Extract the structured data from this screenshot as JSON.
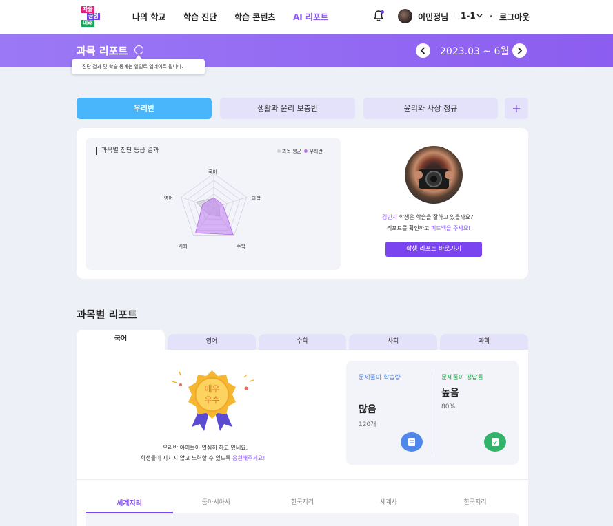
{
  "nav": {
    "logo_lines": [
      "자율",
      "균형",
      "미래"
    ],
    "items": [
      "나의 학교",
      "학습 진단",
      "학습 콘텐츠",
      "AI 리포트"
    ],
    "active_index": 3,
    "user_name": "이민정님",
    "class_select": "1-1",
    "logout": "로그아웃"
  },
  "banner": {
    "title": "과목 리포트",
    "info_icon": "i",
    "date_range": "2023.03 ~ 6월",
    "tooltip": "진단 결과 및 학습 통계는 일일로 업데이트 됩니다."
  },
  "class_tabs": [
    "우리반",
    "생활과 윤리 보충반",
    "윤리와 사상 정규"
  ],
  "class_tab_add": "+",
  "radar": {
    "title": "과목별 진단 등급 결과",
    "legend": [
      {
        "name": "과목 평균",
        "color": "#d0d0d8"
      },
      {
        "name": "우리반",
        "color": "#c07af0"
      }
    ]
  },
  "chart_data": {
    "type": "radar",
    "title": "과목별 진단 등급 결과",
    "categories": [
      "국어",
      "과학",
      "수학",
      "사회",
      "영어"
    ],
    "max": 5,
    "series": [
      {
        "name": "과목 평균",
        "values": [
          1.4,
          0.8,
          1.5,
          1.2,
          2.7
        ]
      },
      {
        "name": "우리반",
        "values": [
          1.5,
          1.4,
          4.8,
          4.5,
          1.7
        ]
      }
    ]
  },
  "student": {
    "name": "김민지",
    "msg1_rest": " 학생은 학습을 잘하고 있을까요?",
    "msg2_pre": "리포트를 확인하고 ",
    "msg2_link": "피드백을 주세요!",
    "button": "학생 리포트 바로가기"
  },
  "section": {
    "title": "과목별 리포트"
  },
  "subject_tabs": [
    "국어",
    "영어",
    "수학",
    "사회",
    "과학"
  ],
  "medal": {
    "text_top": "매우",
    "text_bottom": "우수",
    "msg1": "우리반 아이들이 열심히 하고 있네요.",
    "msg2_pre": "학생들이 지치지 않고 노력할 수 있도록 ",
    "msg2_link": "응원해주세요!"
  },
  "stats": {
    "volume_label": "문제풀이 학습량",
    "volume_value": "많음",
    "volume_sub": "120개",
    "accuracy_label": "문제풀이 정답률",
    "accuracy_value": "높음",
    "accuracy_sub": "80%",
    "volume_color": "#4f87ea",
    "accuracy_color": "#31b46a"
  },
  "topic_tabs": [
    "세계지리",
    "동아시아사",
    "한국지리",
    "세계사",
    "한국지리"
  ]
}
